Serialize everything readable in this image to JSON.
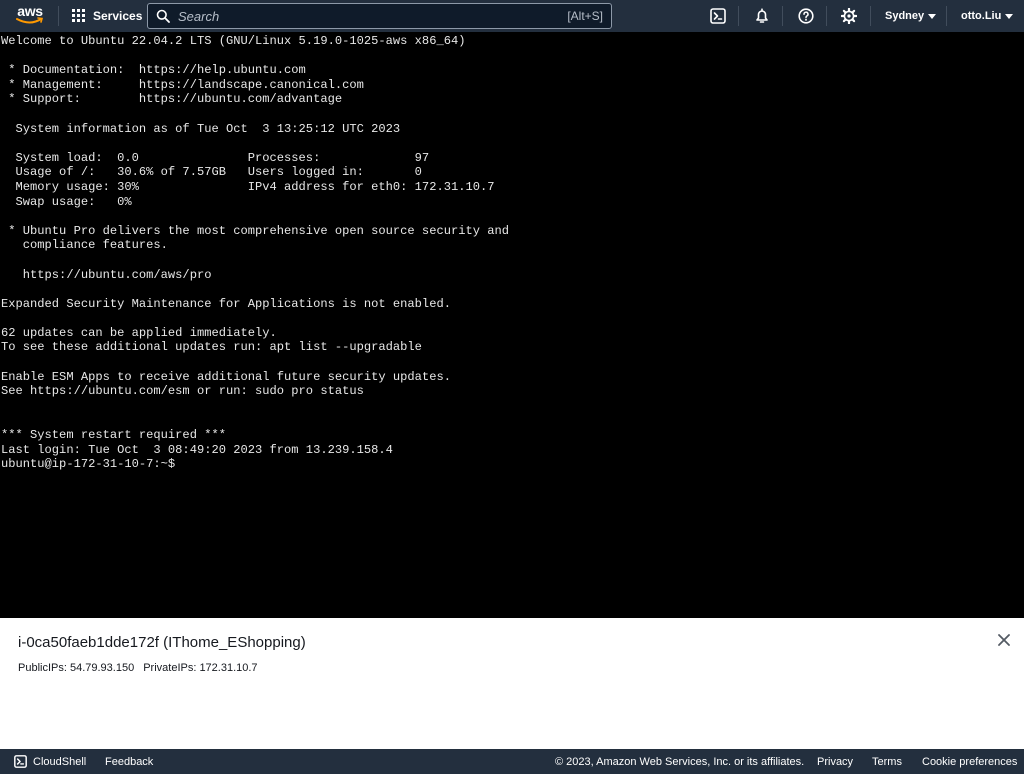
{
  "nav": {
    "logo_text": "aws",
    "services_label": "Services",
    "search_placeholder": "Search",
    "search_shortcut": "[Alt+S]",
    "region": "Sydney",
    "user": "otto.Liu",
    "icons": [
      "cloudshell-icon",
      "bell-icon",
      "help-icon",
      "gear-icon"
    ]
  },
  "terminal": {
    "lines": [
      "Welcome to Ubuntu 22.04.2 LTS (GNU/Linux 5.19.0-1025-aws x86_64)",
      "",
      " * Documentation:  https://help.ubuntu.com",
      " * Management:     https://landscape.canonical.com",
      " * Support:        https://ubuntu.com/advantage",
      "",
      "  System information as of Tue Oct  3 13:25:12 UTC 2023",
      "",
      "  System load:  0.0               Processes:             97",
      "  Usage of /:   30.6% of 7.57GB   Users logged in:       0",
      "  Memory usage: 30%               IPv4 address for eth0: 172.31.10.7",
      "  Swap usage:   0%",
      "",
      " * Ubuntu Pro delivers the most comprehensive open source security and",
      "   compliance features.",
      "",
      "   https://ubuntu.com/aws/pro",
      "",
      "Expanded Security Maintenance for Applications is not enabled.",
      "",
      "62 updates can be applied immediately.",
      "To see these additional updates run: apt list --upgradable",
      "",
      "Enable ESM Apps to receive additional future security updates.",
      "See https://ubuntu.com/esm or run: sudo pro status",
      "",
      "",
      "*** System restart required ***",
      "Last login: Tue Oct  3 08:49:20 2023 from 13.239.158.4",
      "ubuntu@ip-172-31-10-7:~$"
    ]
  },
  "instance": {
    "title": "i-0ca50faeb1dde172f (IThome_EShopping)",
    "public_ips": "PublicIPs: 54.79.93.150",
    "private_ips": "PrivateIPs: 172.31.10.7"
  },
  "footer": {
    "cloudshell": "CloudShell",
    "feedback": "Feedback",
    "copyright": "© 2023, Amazon Web Services, Inc. or its affiliates.",
    "privacy": "Privacy",
    "terms": "Terms",
    "cookie": "Cookie preferences"
  },
  "colors": {
    "nav_bg": "#232f3e",
    "terminal_bg": "#000000",
    "terminal_fg": "#e8e8e8",
    "aws_orange": "#ff9900"
  }
}
